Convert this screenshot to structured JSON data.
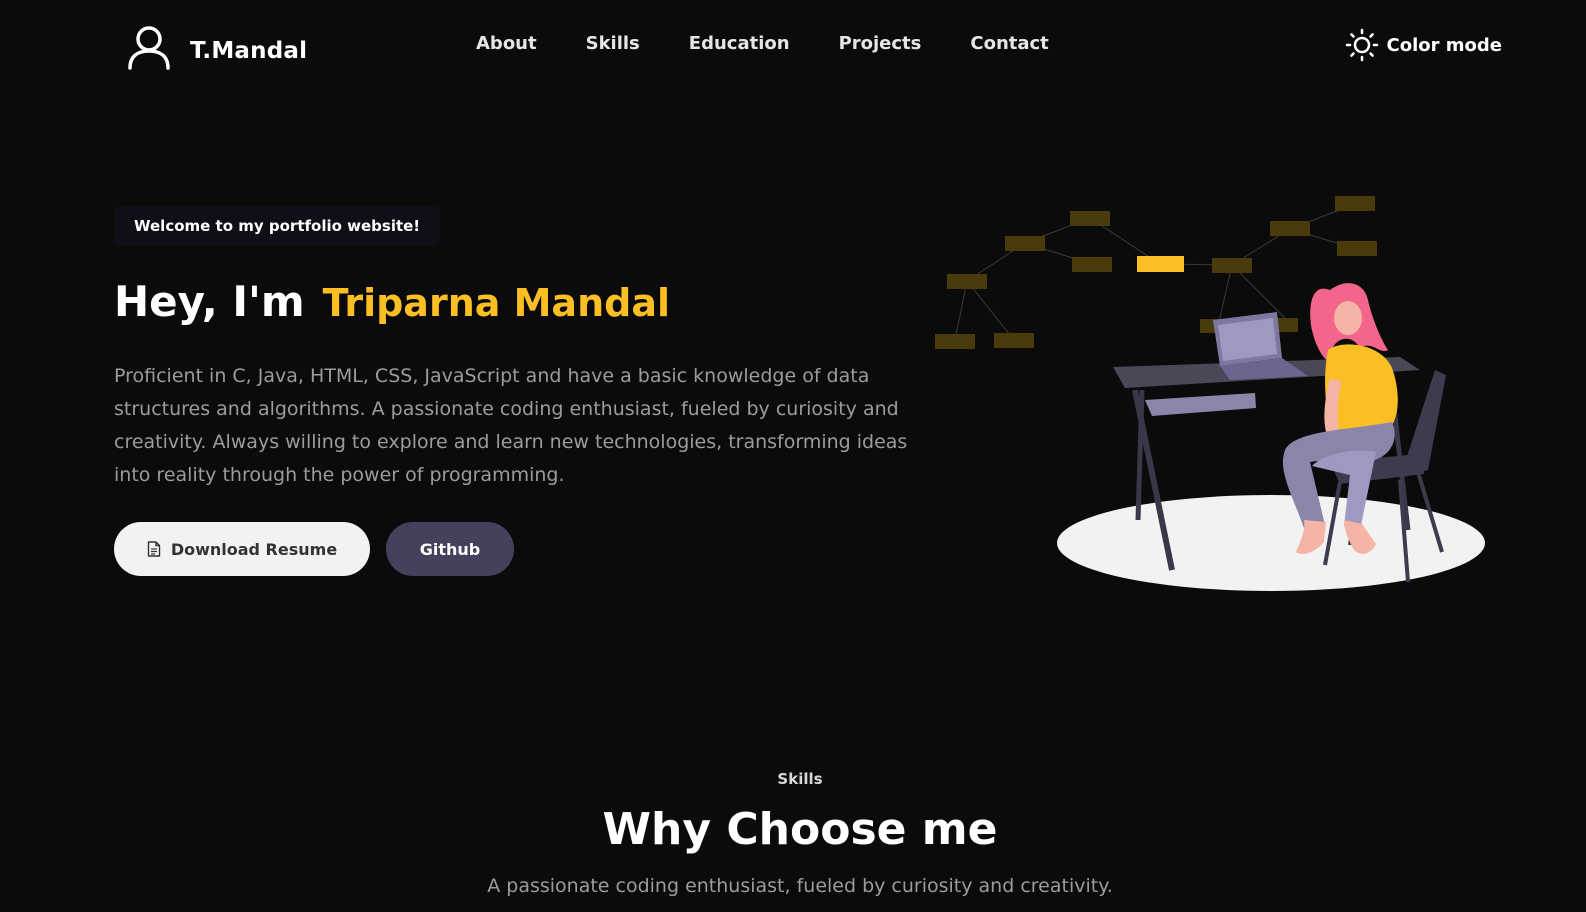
{
  "brand": {
    "name": "T.Mandal",
    "icon": "user-icon"
  },
  "nav": {
    "links": [
      "About",
      "Skills",
      "Education",
      "Projects",
      "Contact"
    ],
    "color_mode_label": "Color mode",
    "color_mode_icon": "sun-icon"
  },
  "hero": {
    "badge": "Welcome to my portfolio website!",
    "greeting": "Hey, I'm",
    "name": "Triparna Mandal",
    "description": "Proficient in C, Java, HTML, CSS, JavaScript and have a basic knowledge of data structures and algorithms. A passionate coding enthusiast, fueled by curiosity and creativity. Always willing to explore and learn new technologies, transforming ideas into reality through the power of programming.",
    "resume_button": "Download Resume",
    "resume_icon": "document-icon",
    "github_button": "Github"
  },
  "skills_section": {
    "eyebrow": "Skills",
    "title": "Why Choose me",
    "subtitle": "A passionate coding enthusiast, fueled by curiosity and creativity."
  },
  "colors": {
    "background": "#0b0b0b",
    "accent": "#fbbf24",
    "secondary_button": "#45415c",
    "text_muted": "#9c9c9c"
  }
}
